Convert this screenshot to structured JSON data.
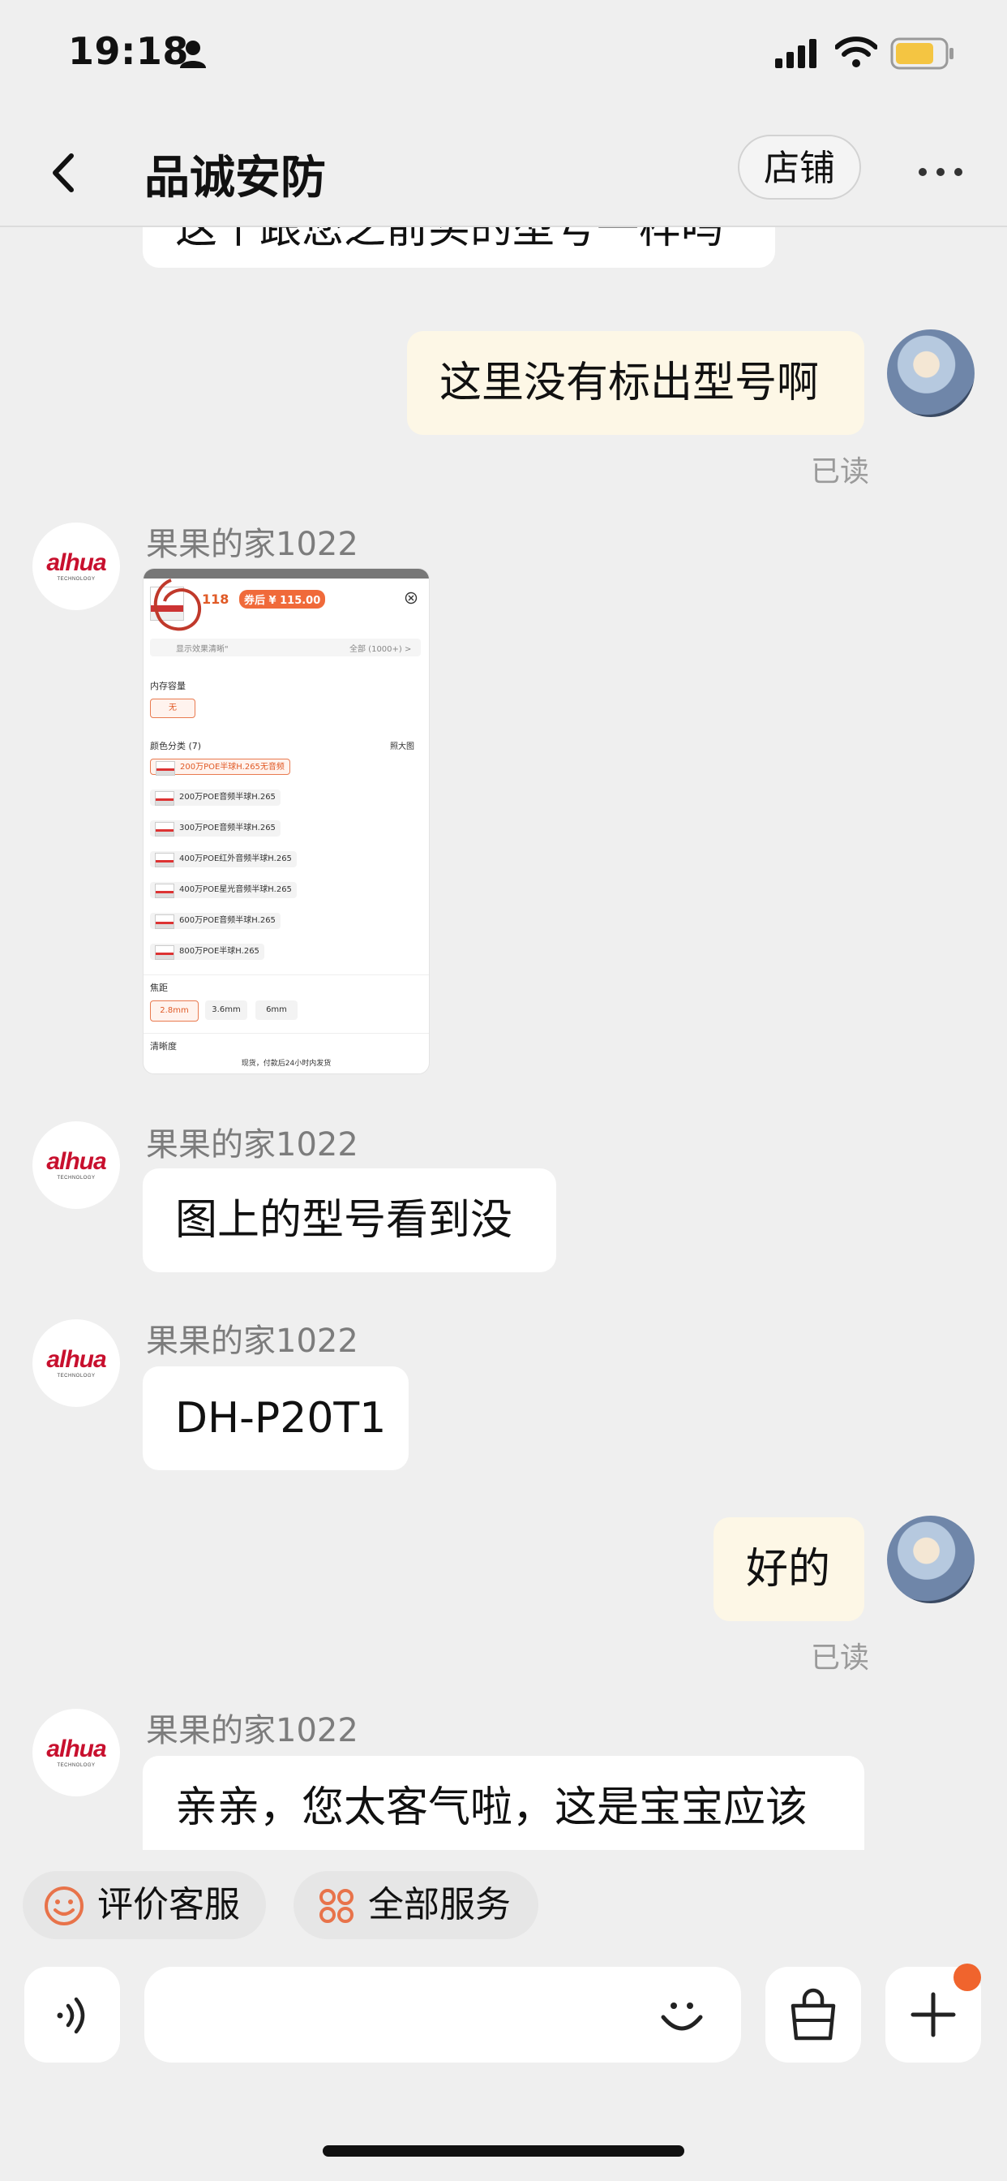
{
  "status_bar": {
    "time": "19:18"
  },
  "header": {
    "title": "品诚安防",
    "store_button": "店铺"
  },
  "messages": {
    "m0_partial": "这个跟您之前买的型号一样吗",
    "m1_mine": "这里没有标出型号啊",
    "m1_read": "已读",
    "m2_sender": "果果的家1022",
    "m3_sender": "果果的家1022",
    "m3_text": "图上的型号看到没",
    "m4_sender": "果果的家1022",
    "m4_text": "DH-P20T1",
    "m5_mine": "好的",
    "m5_read": "已读",
    "m6_sender": "果果的家1022",
    "m6_text": "亲亲，您太客气啦，这是宝宝应该"
  },
  "product_screenshot": {
    "price_prefix": "118",
    "price_tag": "券后 ¥ 115.00",
    "search_row": "显示效果清晰\"",
    "all_count": "全部 (1000+) >",
    "memory_label": "内存容量",
    "memory_option": "无",
    "color_label": "颜色分类 (7)",
    "big_image": "照大图",
    "options": [
      "200万POE半球H.265无音频",
      "200万POE音频半球H.265",
      "300万POE音频半球H.265",
      "400万POE红外音频半球H.265",
      "400万POE星光音频半球H.265",
      "600万POE音频半球H.265",
      "800万POE半球H.265"
    ],
    "focal_label": "焦距",
    "focal_options": [
      "2.8mm",
      "3.6mm",
      "6mm"
    ],
    "clarity_label": "清晰度",
    "footer_note": "现货，付款后24小时内发货"
  },
  "avatars": {
    "brand_logo_text": "alhua",
    "brand_logo_sub": "TECHNOLOGY"
  },
  "actions": {
    "review_service": "评价客服",
    "all_services": "全部服务"
  },
  "colors": {
    "accent": "#e8734a",
    "notification_dot": "#f0642d",
    "mine_bubble": "#fdf7e6"
  },
  "icons": [
    "person-icon",
    "signal-icon",
    "wifi-icon",
    "battery-icon",
    "back-icon",
    "more-icon",
    "voice-icon",
    "emoji-icon",
    "bag-icon",
    "plus-icon",
    "smile-icon",
    "grid-icon"
  ]
}
